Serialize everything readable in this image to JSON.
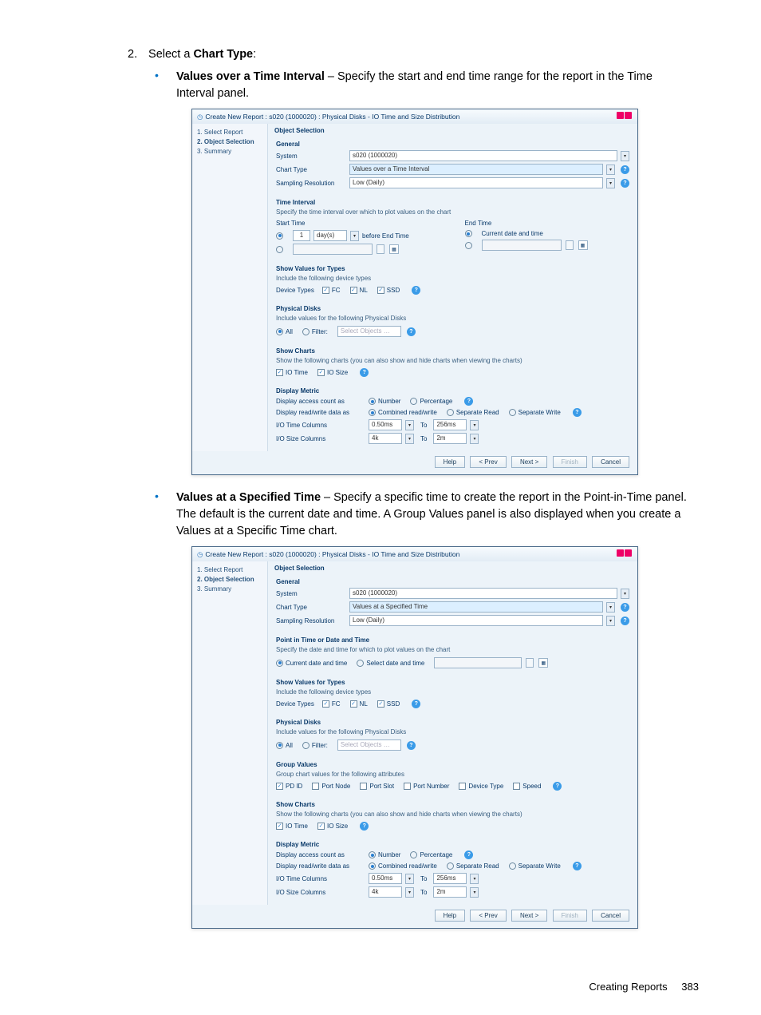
{
  "doc": {
    "step2_num": "2.",
    "step2_text_a": "Select a ",
    "step2_bold": "Chart Type",
    "step2_text_b": ":",
    "bullet1_head": "Values over a Time Interval",
    "bullet1_body": " – Specify the start and end time range for the report in the Time Interval panel.",
    "bullet2_head": "Values at a Specified Time",
    "bullet2_body": " – Specify a specific time to create the report in the Point-in-Time panel. The default is the current date and time. A Group Values panel is also displayed when you create a Values at a Specific Time chart.",
    "footer_text": "Creating Reports",
    "footer_page": "383"
  },
  "dlg1": {
    "title": "Create New Report : s020 (1000020) : Physical Disks - IO Time and Size Distribution",
    "steps": {
      "a": "1. Select Report",
      "b": "2. Object Selection",
      "c": "3. Summary"
    },
    "panel_title": "Object Selection",
    "general": {
      "head": "General",
      "system_lbl": "System",
      "system_val": "s020 (1000020)",
      "charttype_lbl": "Chart Type",
      "charttype_val": "Values over a Time Interval",
      "sampres_lbl": "Sampling Resolution",
      "sampres_val": "Low (Daily)"
    },
    "ti": {
      "head": "Time Interval",
      "desc": "Specify the time interval over which to plot values on the chart",
      "start_head": "Start Time",
      "end_head": "End Time",
      "before_num": "1",
      "before_unit": "day(s)",
      "before_lbl": "before End Time",
      "curr_lbl": "Current date and time"
    },
    "svt": {
      "head": "Show Values for Types",
      "desc": "Include the following device types",
      "dt_lbl": "Device Types",
      "fc": "FC",
      "nl": "NL",
      "ssd": "SSD"
    },
    "pd": {
      "head": "Physical Disks",
      "desc": "Include values for the following Physical Disks",
      "all": "All",
      "filter": "Filter:",
      "sel": "Select Objects …"
    },
    "sc": {
      "head": "Show Charts",
      "desc": "Show the following charts (you can also show and hide charts when viewing the charts)",
      "iotime": "IO Time",
      "iosize": "IO Size"
    },
    "dm": {
      "head": "Display Metric",
      "access_lbl": "Display access count as",
      "number": "Number",
      "pct": "Percentage",
      "rw_lbl": "Display read/write data as",
      "combined": "Combined read/write",
      "sepread": "Separate Read",
      "sepwrite": "Separate Write",
      "iotc_lbl": "I/O Time Columns",
      "iotc_from": "0.50ms",
      "iotc_to_lbl": "To",
      "iotc_to": "256ms",
      "iosc_lbl": "I/O Size Columns",
      "iosc_from": "4k",
      "iosc_to_lbl": "To",
      "iosc_to": "2m"
    },
    "btns": {
      "help": "Help",
      "prev": "< Prev",
      "next": "Next >",
      "finish": "Finish",
      "cancel": "Cancel"
    }
  },
  "dlg2": {
    "title": "Create New Report : s020 (1000020) : Physical Disks - IO Time and Size Distribution",
    "steps": {
      "a": "1. Select Report",
      "b": "2. Object Selection",
      "c": "3. Summary"
    },
    "panel_title": "Object Selection",
    "general": {
      "head": "General",
      "system_lbl": "System",
      "system_val": "s020 (1000020)",
      "charttype_lbl": "Chart Type",
      "charttype_val": "Values at a Specified Time",
      "sampres_lbl": "Sampling Resolution",
      "sampres_val": "Low (Daily)"
    },
    "pit": {
      "head": "Point in Time or Date and Time",
      "desc": "Specify the date and time for which to plot values on the chart",
      "curr": "Current date and time",
      "sel": "Select date and time"
    },
    "svt": {
      "head": "Show Values for Types",
      "desc": "Include the following device types",
      "dt_lbl": "Device Types",
      "fc": "FC",
      "nl": "NL",
      "ssd": "SSD"
    },
    "pd": {
      "head": "Physical Disks",
      "desc": "Include values for the following Physical Disks",
      "all": "All",
      "filter": "Filter:",
      "sel": "Select Objects …"
    },
    "gv": {
      "head": "Group Values",
      "desc": "Group chart values for the following attributes",
      "pdid": "PD ID",
      "portnode": "Port Node",
      "portslot": "Port Slot",
      "portnum": "Port Number",
      "devtype": "Device Type",
      "speed": "Speed"
    },
    "sc": {
      "head": "Show Charts",
      "desc": "Show the following charts (you can also show and hide charts when viewing the charts)",
      "iotime": "IO Time",
      "iosize": "IO Size"
    },
    "dm": {
      "head": "Display Metric",
      "access_lbl": "Display access count as",
      "number": "Number",
      "pct": "Percentage",
      "rw_lbl": "Display read/write data as",
      "combined": "Combined read/write",
      "sepread": "Separate Read",
      "sepwrite": "Separate Write",
      "iotc_lbl": "I/O Time Columns",
      "iotc_from": "0.50ms",
      "iotc_to_lbl": "To",
      "iotc_to": "256ms",
      "iosc_lbl": "I/O Size Columns",
      "iosc_from": "4k",
      "iosc_to_lbl": "To",
      "iosc_to": "2m"
    },
    "btns": {
      "help": "Help",
      "prev": "< Prev",
      "next": "Next >",
      "finish": "Finish",
      "cancel": "Cancel"
    }
  }
}
